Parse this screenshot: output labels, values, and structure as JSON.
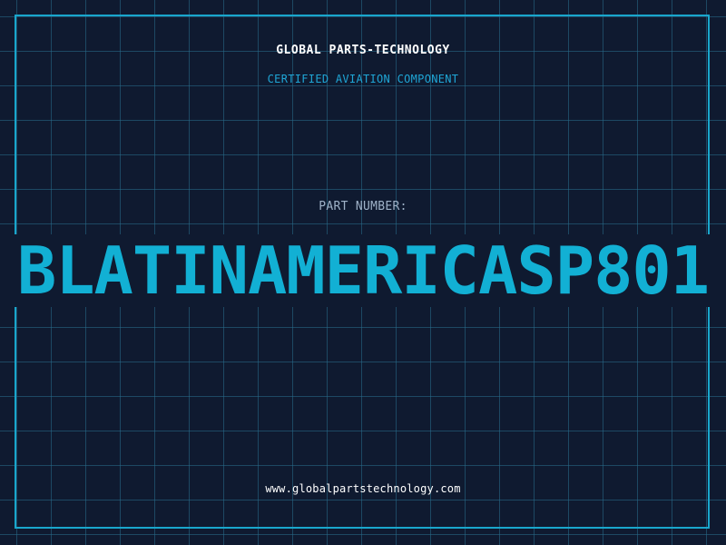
{
  "header": {
    "company": "GLOBAL PARTS-TECHNOLOGY",
    "subtitle": "CERTIFIED AVIATION COMPONENT"
  },
  "part": {
    "label": "PART NUMBER:",
    "number": "BLATINAMERICASP801"
  },
  "footer": {
    "website": "www.globalpartstechnology.com"
  },
  "colors": {
    "background": "#0f1a30",
    "grid": "#286e8c",
    "frame": "#19a6cc",
    "accent": "#12b0d4",
    "label": "#9fb2c8",
    "text": "#ffffff"
  }
}
